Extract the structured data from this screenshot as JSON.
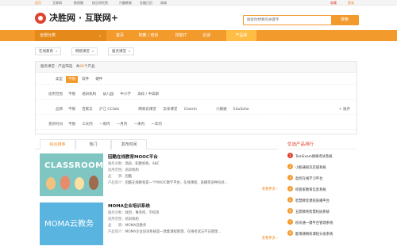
{
  "topbar": {
    "nav": [
      "首页",
      "互联网",
      "影视圈",
      "校企研究院",
      "兴趣教育",
      "金融日历",
      "商城"
    ],
    "right": [
      "收藏",
      "登录"
    ]
  },
  "header": {
    "logo": "决胜网 · 互联网+",
    "search_placeholder": "搜索你想要的关键字",
    "search_button": "搜索"
  },
  "nav": {
    "category": "全部分类",
    "items": [
      "首页",
      "职教 / 培训",
      "技能IT",
      "访谈",
      "产品库"
    ],
    "active_index": 4
  },
  "filters": {
    "dropdowns": [
      "在线教育",
      "网络课堂",
      "服务课堂"
    ],
    "panel_head": "服务课堂 · 产品筛选",
    "panel_count_prefix": "共",
    "panel_count": "86",
    "panel_count_suffix": "个产品",
    "rows": [
      {
        "label": "类型",
        "options": [
          "不限",
          "软件",
          "硬件"
        ],
        "selected": 0
      },
      {
        "label": "适用范围",
        "options": [
          "不限",
          "培训机构",
          "幼儿园",
          "中小学",
          "高校 / 中高职"
        ],
        "selected": -1
      },
      {
        "label": "品牌",
        "options": [
          "不限",
          "百家云",
          "沪江 CCtalk",
          "网易云课堂",
          "云朵课堂",
          "ClassIn",
          "小鹅通",
          "EduSoho"
        ],
        "selected": -1,
        "more": "+ 展开"
      },
      {
        "label": "更新时间",
        "options": [
          "不限",
          "三天内",
          "一周内",
          "一月内",
          "一季内",
          "一年内"
        ],
        "selected": -1
      }
    ]
  },
  "tabs": [
    "综合排序",
    "热门",
    "发布时间"
  ],
  "active_tab": 0,
  "products": [
    {
      "thumb_text": "CLASSROOM",
      "title": "因酷在线教育MOOC平台",
      "lines": [
        {
          "k": "服务对象：",
          "v": "高校、职教机构、ABC"
        },
        {
          "k": "适用范围：",
          "v": "培训机构"
        },
        {
          "k": "品　　牌：",
          "v": "因酷"
        },
        {
          "k": "产品简介：",
          "v": "因酷在线教育是一个MOOC教学平台，在线课程、直播等多种形式..."
        }
      ],
      "detail": "查看更多 ›"
    },
    {
      "thumb_text": "MOMA云教务",
      "title": "MOMA企业培训系统",
      "lines": [
        {
          "k": "服务对象：",
          "v": "政府、事务所、学校等"
        },
        {
          "k": "适用范围：",
          "v": "培训机构"
        },
        {
          "k": "品　　牌：",
          "v": "MOMA云教务"
        },
        {
          "k": "产品简介：",
          "v": "MOMA企业培训系统是一款集课程管理、在线考试与学员管理..."
        }
      ],
      "detail": "查看更多 ›"
    }
  ],
  "ranking": {
    "title": "优选产品排行",
    "items": [
      "TomExam网络考试系统",
      "小鹅通知识店铺系统",
      "盈控在线学习平台",
      "校管家教育信息系统",
      "智慧教室课程直播平台",
      "五鼎教育智慧校园系统",
      "校讯通一键平台管理系统",
      "能博通网校课程分发系统"
    ]
  },
  "colors": {
    "accent": "#f39a2c",
    "brand_red": "#e0432f"
  }
}
